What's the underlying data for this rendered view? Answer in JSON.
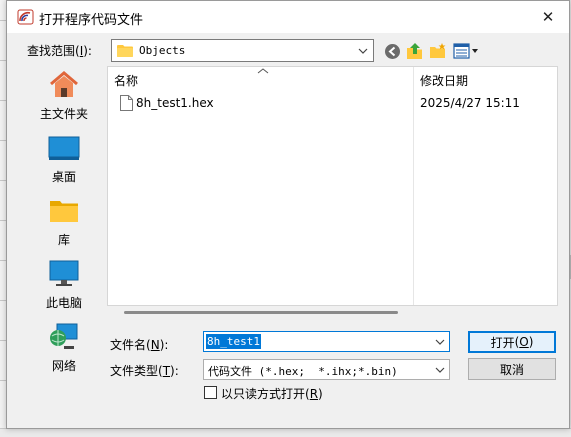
{
  "window": {
    "title": "打开程序代码文件",
    "close_glyph": "✕"
  },
  "lookin": {
    "label_text": "查找范围",
    "label_paren_open": "(",
    "label_key": "I",
    "label_paren_close": "):",
    "value": "Objects"
  },
  "places": [
    {
      "label": "主文件夹",
      "icon": "home-icon"
    },
    {
      "label": "桌面",
      "icon": "desktop-icon"
    },
    {
      "label": "库",
      "icon": "library-folder-icon"
    },
    {
      "label": "此电脑",
      "icon": "computer-icon"
    },
    {
      "label": "网络",
      "icon": "network-icon"
    }
  ],
  "filelist": {
    "columns": [
      "名称",
      "修改日期"
    ],
    "files": [
      {
        "name": "8h_test1.hex",
        "date": "2025/4/27 15:11"
      }
    ]
  },
  "filename": {
    "label_text": "文件名",
    "label_paren_open": "(",
    "label_key": "N",
    "label_paren_close": "):",
    "value": "8h_test1"
  },
  "filetype": {
    "label_text": "文件类型",
    "label_paren_open": "(",
    "label_key": "T",
    "label_paren_close": "):",
    "value": "代码文件 (*.hex;  *.ihx;*.bin)"
  },
  "readonly": {
    "label_text": "以只读方式打开",
    "label_paren_open": "(",
    "label_key": "R",
    "label_paren_close": ")",
    "checked": false
  },
  "buttons": {
    "open_text": "打开",
    "open_paren_open": "(",
    "open_key": "O",
    "open_paren_close": ")",
    "cancel": "取消"
  },
  "colors": {
    "accent": "#0078d7",
    "folder": "#ffc83d",
    "selection": "#0078d7"
  }
}
